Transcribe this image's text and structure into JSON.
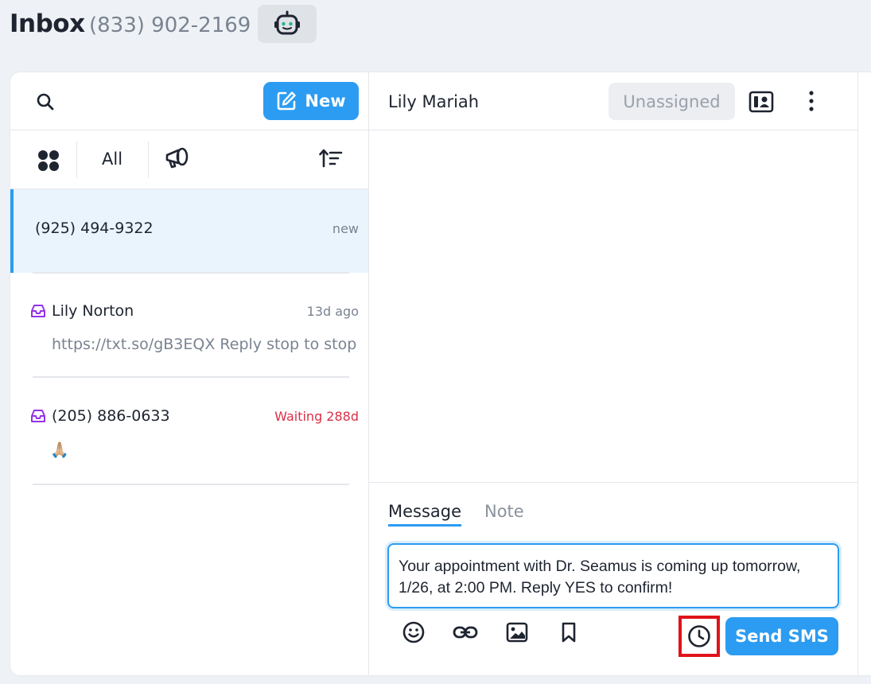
{
  "header": {
    "title": "Inbox",
    "phone": "(833) 902-2169",
    "bot_icon": "robot-icon"
  },
  "left_pane": {
    "new_button": "New",
    "filters": {
      "all_label": "All"
    },
    "conversations": [
      {
        "name": "(925) 494-9322",
        "time": "new",
        "preview": "",
        "active": true
      },
      {
        "name": "Lily Norton",
        "time": "13d ago",
        "preview": "https://txt.so/gB3EQX Reply stop to stop",
        "active": false
      },
      {
        "name": "(205) 886-0633",
        "time": "Waiting 288d",
        "preview": "🙏🏼",
        "active": false,
        "time_color": "#dc2f45"
      }
    ]
  },
  "conversation": {
    "contact_name": "Lily Mariah",
    "assign_label": "Unassigned",
    "tabs": {
      "message": "Message",
      "note": "Note"
    },
    "message_text": "Your appointment with Dr. Seamus is coming up tomorrow, 1/26, at 2:00 PM. Reply YES to confirm!",
    "send_button": "Send SMS"
  },
  "colors": {
    "accent": "#2b9cf2",
    "inbox_icon": "#9333ea",
    "waiting": "#dc2f45",
    "highlight": "#e0131b"
  }
}
